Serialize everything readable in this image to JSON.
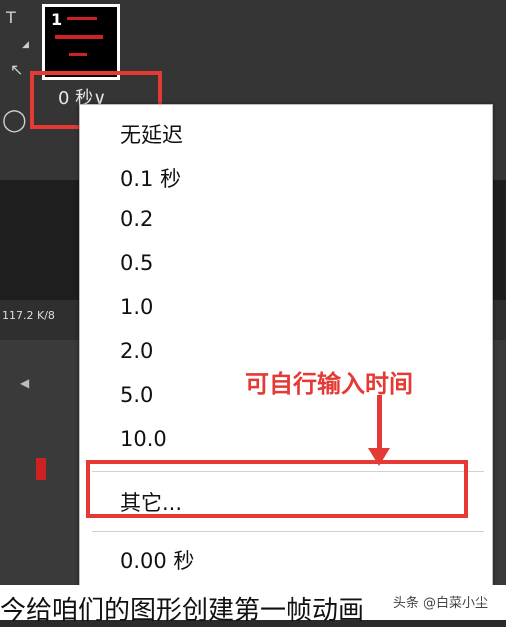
{
  "frame": {
    "number": "1",
    "delay_label": "0 秒∨"
  },
  "status": {
    "file_size": "117.2 K/8"
  },
  "menu": {
    "items": [
      "无延迟",
      "0.1 秒",
      "0.2",
      "0.5",
      "1.0",
      "2.0",
      "5.0",
      "10.0"
    ],
    "other": "其它...",
    "current": "0.00 秒"
  },
  "annotation": {
    "text": "可自行输入时间"
  },
  "caption": {
    "text": "今给咱们的图形创建第一帧动画"
  },
  "watermark": {
    "text": "头条 @白菜小尘"
  },
  "colors": {
    "highlight": "#e53935",
    "menu_bg": "#ffffff"
  }
}
